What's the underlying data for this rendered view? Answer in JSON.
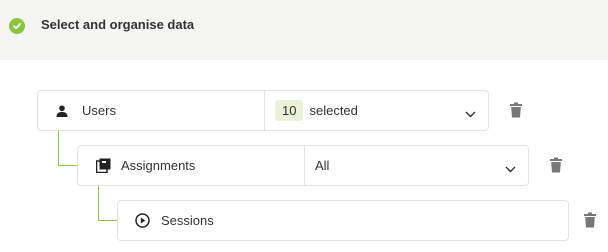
{
  "header": {
    "status_icon": "check-circle-icon",
    "title": "Select and organise data"
  },
  "colors": {
    "accent": "#8cc63f",
    "badge_bg": "#eaf3d8",
    "header_bg": "#f5f6f4"
  },
  "rows": [
    {
      "icon": "user-icon",
      "label": "Users",
      "selection": {
        "count": "10",
        "text": "selected"
      }
    },
    {
      "icon": "stack-icon",
      "label": "Assignments",
      "selection": {
        "text": "All"
      }
    },
    {
      "icon": "play-circle-icon",
      "label": "Sessions"
    }
  ]
}
